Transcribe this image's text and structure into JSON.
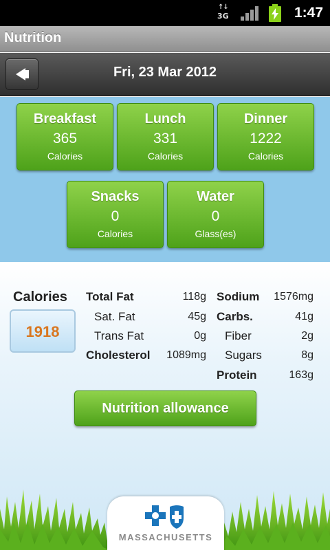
{
  "status_bar": {
    "network": "3G",
    "time": "1:47"
  },
  "app": {
    "title": "Nutrition"
  },
  "header": {
    "date": "Fri, 23 Mar 2012"
  },
  "meals": [
    {
      "name": "Breakfast",
      "value": "365",
      "unit": "Calories"
    },
    {
      "name": "Lunch",
      "value": "331",
      "unit": "Calories"
    },
    {
      "name": "Dinner",
      "value": "1222",
      "unit": "Calories"
    },
    {
      "name": "Snacks",
      "value": "0",
      "unit": "Calories"
    },
    {
      "name": "Water",
      "value": "0",
      "unit": "Glass(es)"
    }
  ],
  "summary": {
    "calories_label": "Calories",
    "calories_value": "1918",
    "nutrients_left": [
      {
        "label": "Total Fat",
        "value": "118g"
      },
      {
        "label": "Sat. Fat",
        "value": "45g"
      },
      {
        "label": "Trans Fat",
        "value": "0g"
      },
      {
        "label": "Cholesterol",
        "value": "1089mg"
      }
    ],
    "nutrients_right": [
      {
        "label": "Sodium",
        "value": "1576mg"
      },
      {
        "label": "Carbs.",
        "value": "41g"
      },
      {
        "label": "Fiber",
        "value": "2g"
      },
      {
        "label": "Sugars",
        "value": "8g"
      },
      {
        "label": "Protein",
        "value": "163g"
      }
    ]
  },
  "actions": {
    "allowance_label": "Nutrition allowance"
  },
  "footer": {
    "brand_text": "MASSACHUSETTS"
  },
  "colors": {
    "tile_green": "#5fb025",
    "sky_blue": "#8fc8ea",
    "calorie_orange": "#d9761f",
    "brand_blue": "#1b75bb"
  },
  "icons": {
    "back": "back-arrow-icon",
    "network": "3g-icon",
    "signal": "signal-icon",
    "battery": "battery-charging-icon",
    "logo": "cross-shield-logo-icon"
  }
}
